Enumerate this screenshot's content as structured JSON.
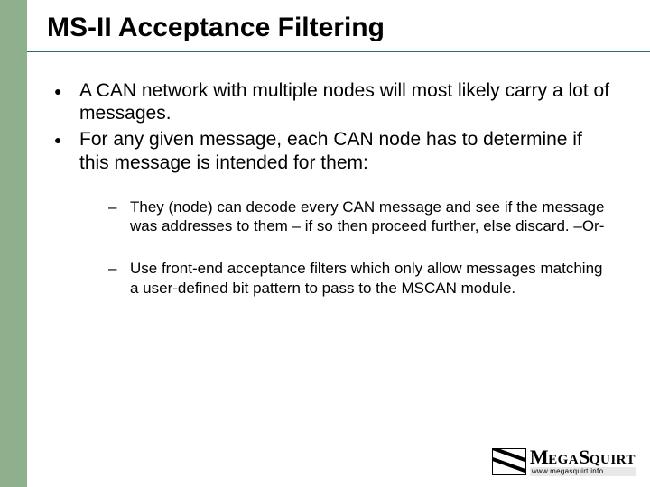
{
  "title": "MS-II Acceptance Filtering",
  "bullets": [
    "A CAN network with multiple nodes will most likely carry a lot of messages.",
    "For any given message, each CAN node has to determine if this message is intended for them:"
  ],
  "sub_bullets": [
    "They (node) can decode every CAN message and see if the message was addresses to them – if so then proceed further, else discard. –Or-",
    "Use front-end acceptance filters which only allow messages matching a user-defined bit pattern to pass to the MSCAN module."
  ],
  "logo": {
    "brand_html": "MegaSquirt",
    "url": "www.megasquirt.info"
  }
}
